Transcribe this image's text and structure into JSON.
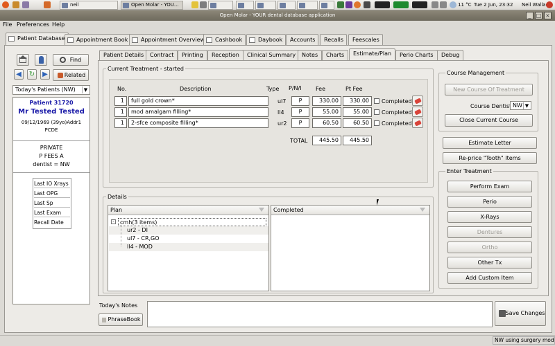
{
  "taskbar": {
    "tasks": [
      "neil",
      "Open Molar - YOU...",
      "",
      "",
      "",
      "",
      "",
      "",
      "",
      "",
      ""
    ],
    "weather": "11 °C",
    "clock": "Tue 2 Jun, 23:32",
    "user": "Neil Wallace"
  },
  "window": {
    "title": "Open Molar - YOUR dental database application"
  },
  "menu": [
    "File",
    "Preferences",
    "Help"
  ],
  "main_tabs": [
    "Patient Database",
    "Appointment Book",
    "Appointment Overview",
    "Cashbook",
    "Daybook",
    "Accounts",
    "Recalls",
    "Feescales"
  ],
  "left": {
    "find_label": "Find",
    "related_label": "Related",
    "todays_patients": "Today's Patients (NW)",
    "patient_number": "Patient 31720",
    "patient_name": "Mr Tested Tested",
    "dob_line": "09/12/1969 (39yo)Addr1",
    "postcode": "PCDE",
    "status_private": "PRIVATE",
    "fees": "P FEES A",
    "dentist": "dentist = NW",
    "history_items": [
      "Last IO Xrays",
      "Last OPG",
      "Last Sp",
      "Last Exam",
      "Recall Date"
    ]
  },
  "sub_tabs": [
    "Patient Details",
    "Contract",
    "Printing",
    "Reception",
    "Clinical Summary",
    "Notes",
    "Charts",
    "Estimate/Plan",
    "Perio Charts",
    "Debug"
  ],
  "current_treatment": {
    "group_label": "Current Treatment - started",
    "headers": {
      "no": "No.",
      "desc": "Description",
      "type": "Type",
      "pni": "P/N/I",
      "fee": "Fee",
      "ptfee": "Pt Fee"
    },
    "rows": [
      {
        "no": "1",
        "desc": "full gold crown*",
        "type": "ul7",
        "pni": "P",
        "fee": "330.00",
        "ptfee": "330.00",
        "completed": "Completed"
      },
      {
        "no": "1",
        "desc": "mod amalgam filling*",
        "type": "ll4",
        "pni": "P",
        "fee": "55.00",
        "ptfee": "55.00",
        "completed": "Completed"
      },
      {
        "no": "1",
        "desc": "2-sfce composite filling*",
        "type": "ur2",
        "pni": "P",
        "fee": "60.50",
        "ptfee": "60.50",
        "completed": "Completed"
      }
    ],
    "total_label": "TOTAL",
    "total_fee": "445.50",
    "total_ptfee": "445.50"
  },
  "details": {
    "group_label": "Details",
    "plan_header": "Plan",
    "completed_header": "Completed",
    "tree_root": "cmh(3 items)",
    "tree_children": [
      "ur2 - DI",
      "ul7 - CR,GO",
      "ll4 - MOD"
    ]
  },
  "course_management": {
    "group_label": "Course Management",
    "new_course": "New Course Of Treatment",
    "course_dentist_label": "Course Dentist",
    "course_dentist_value": "NW",
    "close_course": "Close Current Course",
    "estimate_letter": "Estimate Letter",
    "reprice": "Re-price \"Tooth\" Items",
    "enter_treatment_label": "Enter Treatment",
    "treatment_buttons": [
      "Perform Exam",
      "Perio",
      "X-Rays",
      "Dentures",
      "Ortho",
      "Other Tx",
      "Add Custom Item"
    ]
  },
  "notes": {
    "label": "Today's Notes",
    "phrasebook": "PhraseBook",
    "save": "Save Changes"
  },
  "status": {
    "text": "NW using surgery mode"
  },
  "colors": {
    "patient_blue": "#1a1aa8",
    "titlebar": "#7c7869"
  }
}
